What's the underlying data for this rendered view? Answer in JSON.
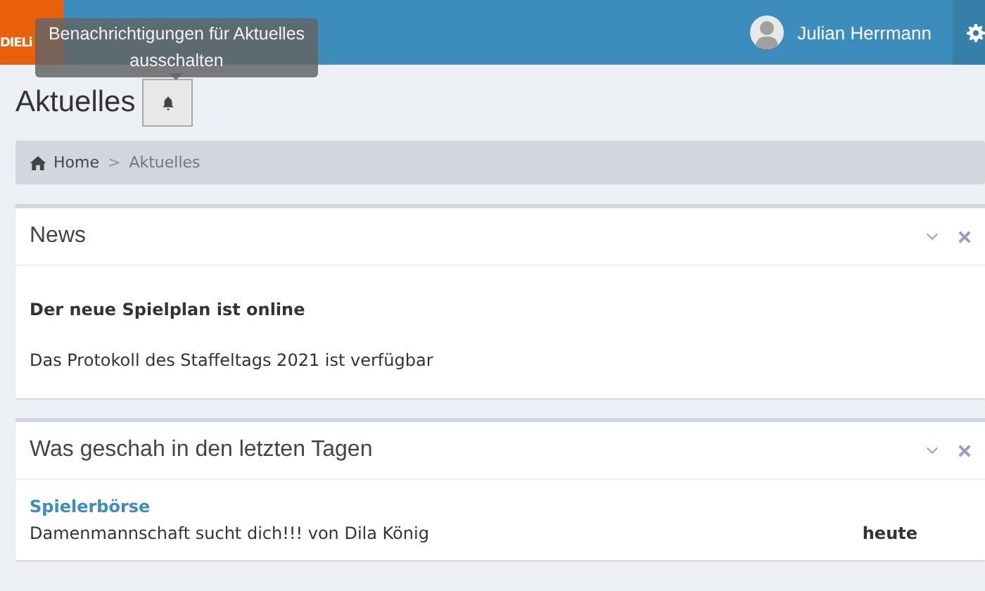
{
  "header": {
    "logo": "DIELi",
    "user_name": "Julian Herrmann"
  },
  "page": {
    "title": "Aktuelles",
    "tooltip": "Benachrichtigungen für Aktuelles ausschalten"
  },
  "breadcrumb": [
    {
      "label": "Home",
      "kind": "home"
    },
    {
      "label": ">",
      "kind": "separator"
    },
    {
      "label": "Aktuelles",
      "kind": "current"
    }
  ],
  "news": {
    "title": "News",
    "items": [
      {
        "text": "Der neue Spielplan ist online",
        "emphasized": true
      },
      {
        "text": "Das Protokoll des Staffeltags 2021 ist verfügbar",
        "emphasized": false
      }
    ]
  },
  "recent": {
    "title": "Was geschah in den letzten Tagen",
    "sections": [
      {
        "title": "Spielerbörse",
        "entries": [
          {
            "text": "Damenmannschaft sucht dich!!! von Dila König",
            "date": "heute"
          }
        ]
      }
    ]
  }
}
